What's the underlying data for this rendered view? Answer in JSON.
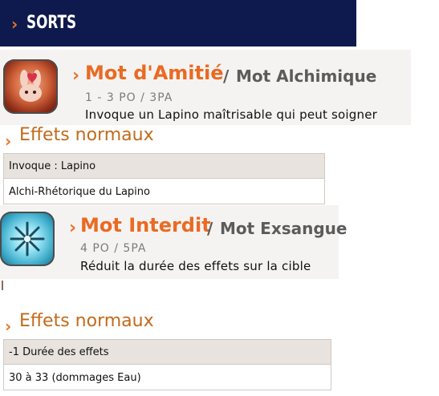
{
  "header": {
    "title": "SORTS"
  },
  "spells": [
    {
      "name": "Mot d'Amitié",
      "slash": "/",
      "alt_name": "Mot Alchimique",
      "meta": "1 - 3 PO / 3PA",
      "description": "Invoque un Lapino maîtrisable qui peut soigner",
      "icon": "rabbit-heart-icon",
      "effects_title": "Effets normaux",
      "effects_header": "Invoque : Lapino",
      "effects_rows": [
        "Alchi-Rhétorique du Lapino"
      ]
    },
    {
      "name": "Mot Interdit",
      "slash": "/",
      "alt_name": "Mot Exsangue",
      "meta": "4 PO / 5PA",
      "description": "Réduit la durée des effets sur la cible",
      "icon": "snowflake-icon",
      "effects_title": "Effets normaux",
      "effects_header": "-1 Durée des effets",
      "effects_rows": [
        "30 à 33 (dommages Eau)"
      ]
    }
  ],
  "colors": {
    "header_bg": "#0e1a4d",
    "accent": "#e8742a",
    "spell_title": "#ea6a23",
    "section_title": "#c26a1b"
  }
}
